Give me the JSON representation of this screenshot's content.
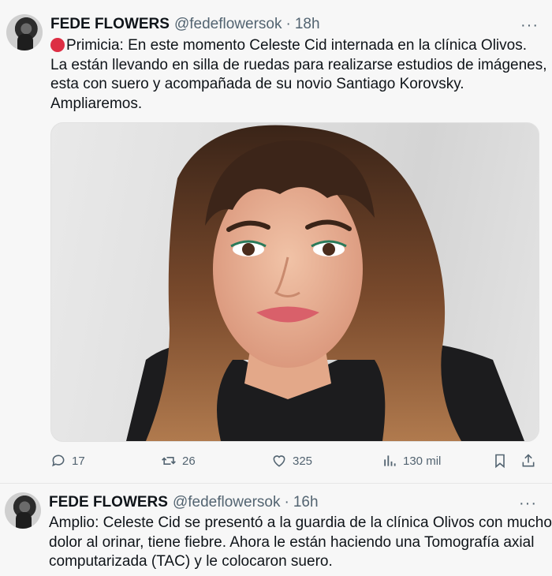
{
  "tweets": [
    {
      "name": "FEDE FLOWERS",
      "handle": "@fedeflowersok",
      "separator": "·",
      "time": "18h",
      "more": "···",
      "lines": [
        "Primicia: En este momento Celeste Cid internada en la clínica Olivos.",
        "La están llevando en silla de ruedas para realizarse estudios de imágenes,",
        "esta con suero y acompañada de su novio Santiago Korovsky.",
        "Ampliaremos."
      ],
      "stats": {
        "replies": "17",
        "reposts": "26",
        "likes": "325",
        "views": "130 mil"
      }
    },
    {
      "name": "FEDE FLOWERS",
      "handle": "@fedeflowersok",
      "separator": "·",
      "time": "16h",
      "more": "···",
      "lines": [
        "Amplio: Celeste Cid se presentó a la guardia de la clínica Olivos con mucho",
        "dolor al orinar, tiene fiebre. Ahora le están haciendo una Tomografía axial",
        "computarizada (TAC) y le colocaron suero."
      ]
    }
  ],
  "colors": {
    "text": "#0f1419",
    "muted": "#536471",
    "alert_dot": "#dd2e44",
    "background": "#f7f7f7"
  },
  "icons": {
    "reply": "reply-icon",
    "repost": "repost-icon",
    "like": "heart-icon",
    "views": "views-chart-icon",
    "bookmark": "bookmark-icon",
    "share": "share-icon",
    "alert": "red-circle-icon",
    "more": "more-icon"
  }
}
